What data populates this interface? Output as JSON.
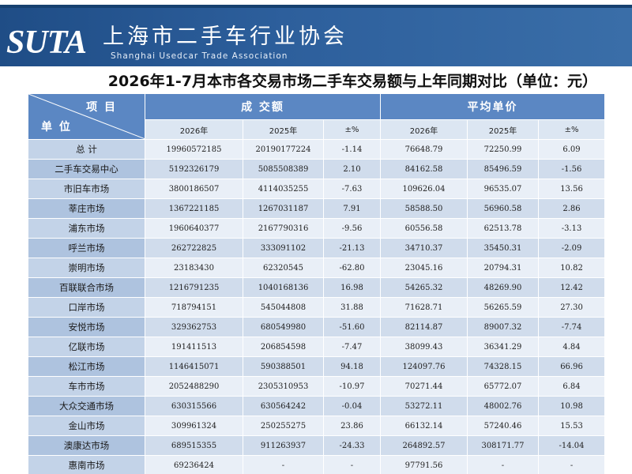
{
  "header": {
    "logo": "SUTA",
    "org_name": "上海市二手车行业协会",
    "org_name_en": "Shanghai Usedcar Trade Association"
  },
  "title": "2026年1-7月本市各交易市场二手车交易额与上年同期对比（单位：元）",
  "table": {
    "corner_top": "项 目",
    "corner_bottom": "单 位",
    "group_headers": [
      "成 交额",
      "平均单价"
    ],
    "sub_headers": [
      "2026年",
      "2025年",
      "±%",
      "2026年",
      "2025年",
      "±%"
    ],
    "rows": [
      {
        "name": "总 计",
        "v": [
          "19960572185",
          "20190177224",
          "-1.14",
          "76648.79",
          "72250.99",
          "6.09"
        ]
      },
      {
        "name": "二手车交易中心",
        "v": [
          "5192326179",
          "5085508389",
          "2.10",
          "84162.58",
          "85496.59",
          "-1.56"
        ]
      },
      {
        "name": "市旧车市场",
        "v": [
          "3800186507",
          "4114035255",
          "-7.63",
          "109626.04",
          "96535.07",
          "13.56"
        ]
      },
      {
        "name": "莘庄市场",
        "v": [
          "1367221185",
          "1267031187",
          "7.91",
          "58588.50",
          "56960.58",
          "2.86"
        ]
      },
      {
        "name": "浦东市场",
        "v": [
          "1960640377",
          "2167790316",
          "-9.56",
          "60556.58",
          "62513.78",
          "-3.13"
        ]
      },
      {
        "name": "呼兰市场",
        "v": [
          "262722825",
          "333091102",
          "-21.13",
          "34710.37",
          "35450.31",
          "-2.09"
        ]
      },
      {
        "name": "崇明市场",
        "v": [
          "23183430",
          "62320545",
          "-62.80",
          "23045.16",
          "20794.31",
          "10.82"
        ]
      },
      {
        "name": "百联联合市场",
        "v": [
          "1216791235",
          "1040168136",
          "16.98",
          "54265.32",
          "48269.90",
          "12.42"
        ]
      },
      {
        "name": "口岸市场",
        "v": [
          "718794151",
          "545044808",
          "31.88",
          "71628.71",
          "56265.59",
          "27.30"
        ]
      },
      {
        "name": "安悦市场",
        "v": [
          "329362753",
          "680549980",
          "-51.60",
          "82114.87",
          "89007.32",
          "-7.74"
        ]
      },
      {
        "name": "亿联市场",
        "v": [
          "191411513",
          "206854598",
          "-7.47",
          "38099.43",
          "36341.29",
          "4.84"
        ]
      },
      {
        "name": "松江市场",
        "v": [
          "1146415071",
          "590388501",
          "94.18",
          "124097.76",
          "74328.15",
          "66.96"
        ]
      },
      {
        "name": "车市市场",
        "v": [
          "2052488290",
          "2305310953",
          "-10.97",
          "70271.44",
          "65772.07",
          "6.84"
        ]
      },
      {
        "name": "大众交通市场",
        "v": [
          "630315566",
          "630564242",
          "-0.04",
          "53272.11",
          "48002.76",
          "10.98"
        ]
      },
      {
        "name": "金山市场",
        "v": [
          "309961324",
          "250255275",
          "23.86",
          "66132.14",
          "57240.46",
          "15.53"
        ]
      },
      {
        "name": "澳康达市场",
        "v": [
          "689515355",
          "911263937",
          "-24.33",
          "264892.57",
          "308171.77",
          "-14.04"
        ]
      },
      {
        "name": "惠南市场",
        "v": [
          "69236424",
          "-",
          "-",
          "97791.56",
          "-",
          "-"
        ]
      }
    ]
  }
}
